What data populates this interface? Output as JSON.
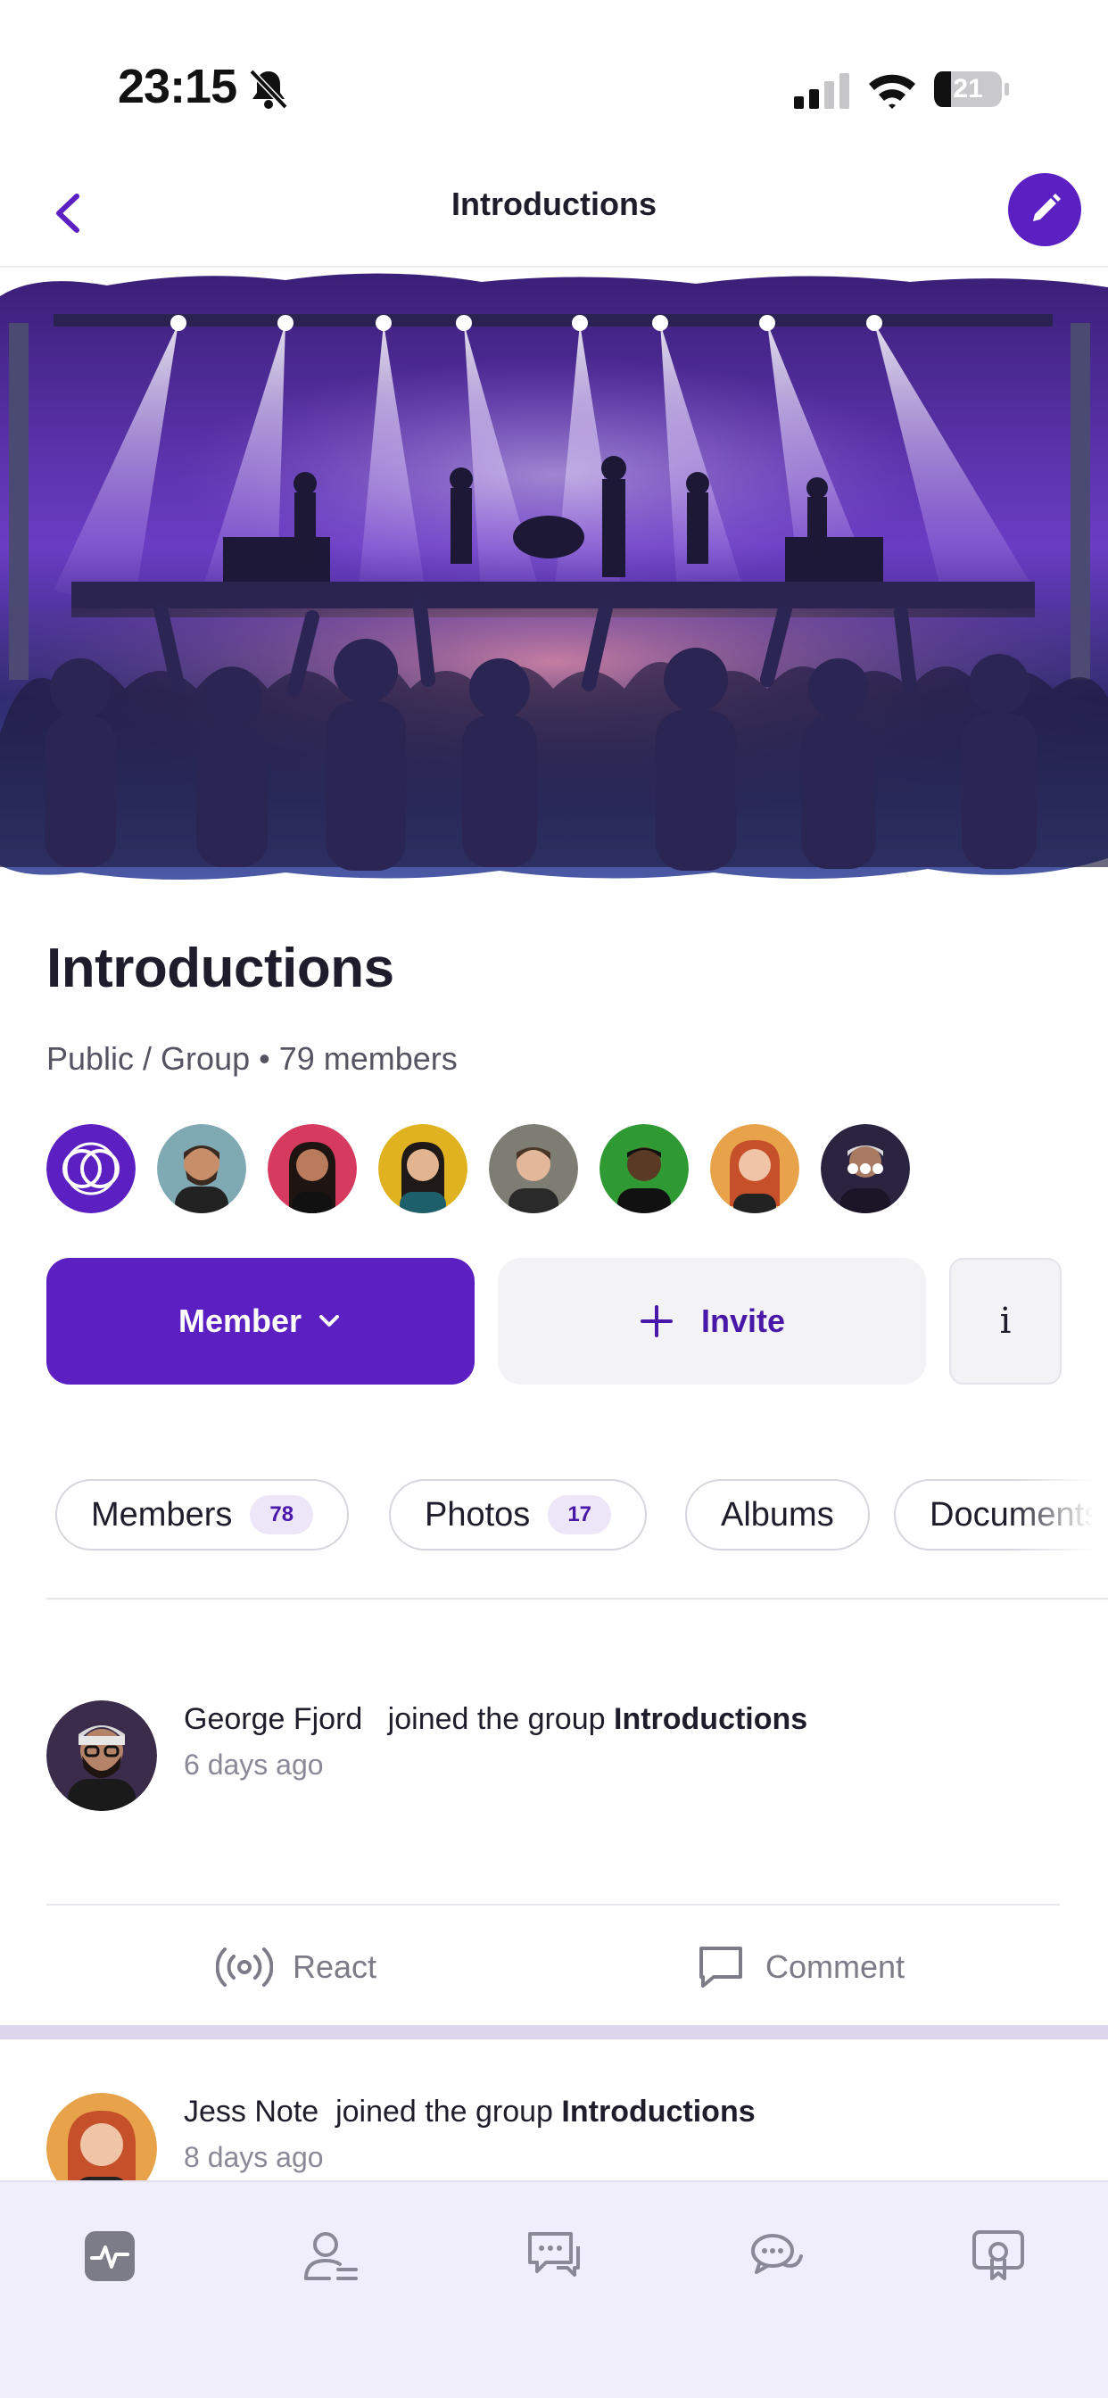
{
  "status_bar": {
    "time": "23:15",
    "battery": "21"
  },
  "nav": {
    "title": "Introductions"
  },
  "group": {
    "title": "Introductions",
    "meta": "Public / Group • 79 members"
  },
  "actions": {
    "member_label": "Member",
    "invite_label": "Invite",
    "info_label": "i"
  },
  "tabs": [
    {
      "label": "Members",
      "count": "78"
    },
    {
      "label": "Photos",
      "count": "17"
    },
    {
      "label": "Albums"
    },
    {
      "label": "Documents"
    }
  ],
  "activities": [
    {
      "name": "George Fjord",
      "action": "joined the group",
      "group": "Introductions",
      "time": "6 days ago"
    },
    {
      "name": "Jess Note",
      "action": "joined the group",
      "group": "Introductions",
      "time": "8 days ago"
    }
  ],
  "post_actions": {
    "react_label": "React",
    "comment_label": "Comment"
  },
  "colors": {
    "accent": "#5b1fc2",
    "tab_count_bg": "#ece6f8",
    "tab_bar_bg": "#f1eefb"
  }
}
